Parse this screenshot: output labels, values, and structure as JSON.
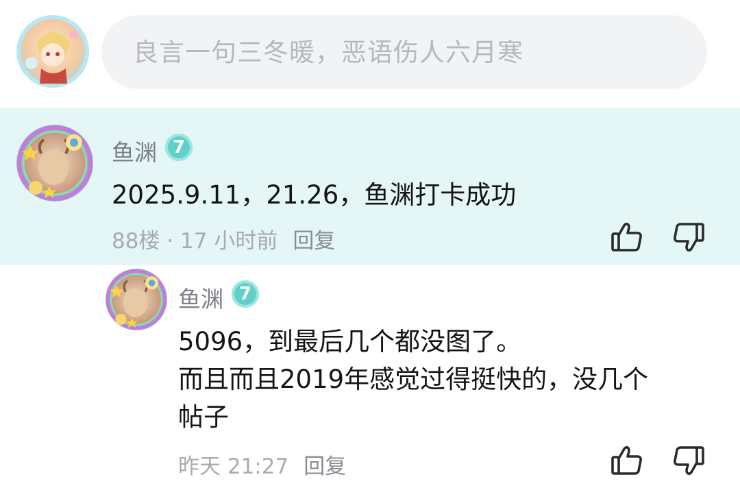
{
  "composer": {
    "placeholder": "良言一句三冬暖，恶语伤人六月寒"
  },
  "comment": {
    "username": "鱼渊",
    "level": "7",
    "text": "2025.9.11，21.26，鱼渊打卡成功",
    "floor": "88楼",
    "separator": " · ",
    "time": "17 小时前",
    "reply_label": "回复",
    "like_icon": "thumbs-up-icon",
    "dislike_icon": "thumbs-down-icon"
  },
  "reply": {
    "username": "鱼渊",
    "level": "7",
    "lines": [
      "5096，到最后几个都没图了。",
      "而且而且2019年感觉过得挺快的，没几个",
      "帖子"
    ],
    "time": "昨天 21:27",
    "reply_label": "回复",
    "like_icon": "thumbs-up-icon",
    "dislike_icon": "thumbs-down-icon"
  },
  "colors": {
    "highlight_bg": "#e4f6f6",
    "level_badge": "#5fd0ca",
    "input_bg": "#f2f3f5"
  }
}
